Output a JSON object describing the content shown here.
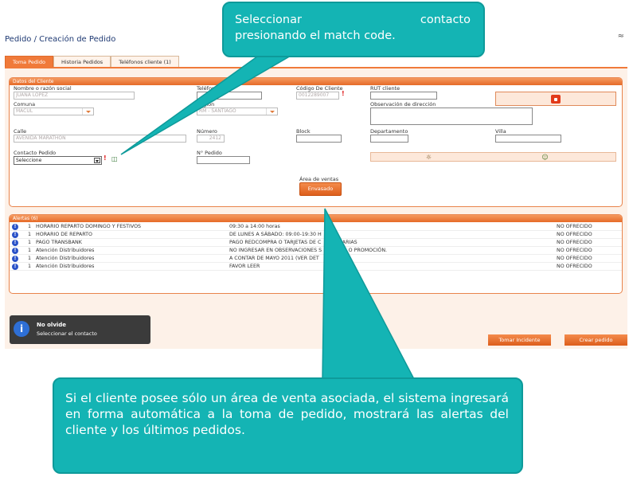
{
  "page_title": "Pedido / Creación de Pedido",
  "corner_mark": "≈",
  "tabs": [
    {
      "label": "Toma Pedido",
      "active": true
    },
    {
      "label": "Historia Pedidos",
      "active": false
    },
    {
      "label": "Teléfonos cliente (1)",
      "active": false
    }
  ],
  "cliente": {
    "header": "Datos del Cliente",
    "nombre_label": "Nombre o razón social",
    "nombre_value": "JUANA LOPEZ",
    "telefono_label": "Teléfono",
    "codigo_label": "Código De Cliente",
    "codigo_value": "0012289007",
    "rut_label": "RUT cliente",
    "comuna_label": "Comuna",
    "comuna_value": "MACUL",
    "region_label": "Región",
    "region_value": "RM - SANTIAGO",
    "obs_label": "Observación de dirección",
    "calle_label": "Calle",
    "calle_value": "AVENIDA MARATHON",
    "numero_label": "Número",
    "numero_value": "2412",
    "block_label": "Block",
    "depto_label": "Departamento",
    "villa_label": "Villa",
    "contacto_label": "Contacto Pedido",
    "contacto_value": "Seleccione",
    "npedido_label": "N° Pedido",
    "area_label": "Área de ventas",
    "area_button": "Envasado"
  },
  "alertas": {
    "header": "Alertas (6)",
    "rows": [
      {
        "num": "1",
        "name": "HORARIO REPARTO DOMINGO Y FESTIVOS",
        "desc": "09:30 a 14:00 horas",
        "status": "NO OFRECIDO"
      },
      {
        "num": "1",
        "name": "HORARIO DE REPARTO",
        "desc": "DE LUNES A SÁBADO: 09:00-19:30 H",
        "status": "NO OFRECIDO"
      },
      {
        "num": "1",
        "name": "PAGO TRANSBANK",
        "desc": "PAGO REDCOMPRA O TARJETAS DE C           CARIAS",
        "status": "NO OFRECIDO"
      },
      {
        "num": "1",
        "name": "Atención Distribuidores",
        "desc": "NO INGRESAR EN OBSERVACIONES S          LES O PROMOCIÓN.",
        "status": "NO OFRECIDO"
      },
      {
        "num": "1",
        "name": "Atención Distribuidores",
        "desc": "A CONTAR DE MAYO 2011 (VER DET",
        "status": "NO OFRECIDO"
      },
      {
        "num": "1",
        "name": "Atención Distribuidores",
        "desc": "FAVOR LEER",
        "status": "NO OFRECIDO"
      }
    ]
  },
  "toast": {
    "title": "No olvide",
    "message": "Seleccionar el contacto"
  },
  "actions": {
    "tomar_incidente": "Tomar Incidente",
    "crear_pedido": "Crear pedido"
  },
  "callout_top": {
    "word1": "Seleccionar",
    "word2": "contacto",
    "line2": "presionando el match code."
  },
  "callout_bottom": "Si el cliente posee sólo un área de venta asociada, el sistema ingresará en forma automática a la toma de pedido, mostrará las alertas del cliente  y los últimos pedidos.",
  "colors": {
    "accent": "#f07a3a",
    "callout": "#14b4b4",
    "info": "#2a52c8"
  }
}
